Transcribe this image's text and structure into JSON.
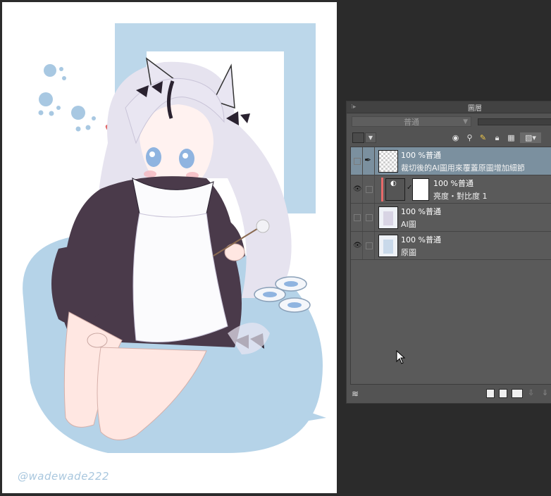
{
  "canvas": {
    "watermark": "@wadewade222"
  },
  "layer_panel": {
    "title": "圖層",
    "blend_mode": "普通",
    "layers": [
      {
        "opacity_mode": "100 %普通",
        "name": "裁切後的AI圖用來覆蓋原圖增加細節",
        "visible": false,
        "selected": true
      },
      {
        "opacity_mode": "100 %普通",
        "name": "亮度・對比度 1",
        "visible": true,
        "selected": false
      },
      {
        "opacity_mode": "100 %普通",
        "name": "AI圖",
        "visible": false,
        "selected": false
      },
      {
        "opacity_mode": "100 %普通",
        "name": "原圖",
        "visible": true,
        "selected": false
      }
    ]
  },
  "colors": {
    "panel_bg": "#535353",
    "selected_row": "#7b909f",
    "clip_indicator": "#e86a6a",
    "canvas_blue": "#b5d3e8"
  }
}
